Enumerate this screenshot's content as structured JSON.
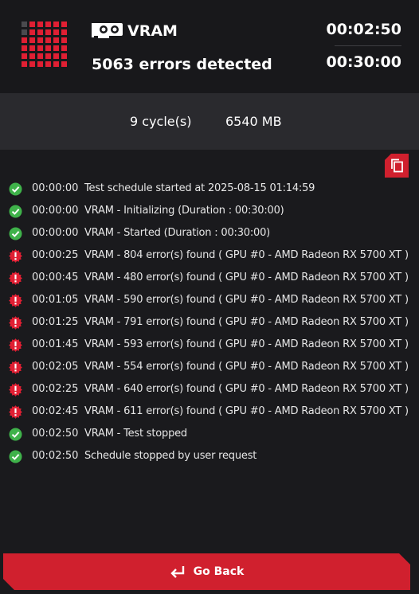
{
  "header": {
    "test_name": "VRAM",
    "errors_text": "5063 errors detected",
    "elapsed_time": "00:02:50",
    "total_time": "00:30:00"
  },
  "stats": {
    "cycles": "9 cycle(s)",
    "memory": "6540 MB"
  },
  "log": [
    {
      "status": "ok",
      "icon": "check-circle-icon",
      "time": "00:00:00",
      "message": "Test schedule started at 2025-08-15 01:14:59"
    },
    {
      "status": "ok",
      "icon": "check-circle-icon",
      "time": "00:00:00",
      "message": "VRAM - Initializing (Duration : 00:30:00)"
    },
    {
      "status": "ok",
      "icon": "check-circle-icon",
      "time": "00:00:00",
      "message": "VRAM - Started (Duration : 00:30:00)"
    },
    {
      "status": "error",
      "icon": "error-gear-icon",
      "time": "00:00:25",
      "message": "VRAM - 804 error(s) found ( GPU #0 - AMD Radeon RX 5700 XT )"
    },
    {
      "status": "error",
      "icon": "error-gear-icon",
      "time": "00:00:45",
      "message": "VRAM - 480 error(s) found ( GPU #0 - AMD Radeon RX 5700 XT )"
    },
    {
      "status": "error",
      "icon": "error-gear-icon",
      "time": "00:01:05",
      "message": "VRAM - 590 error(s) found ( GPU #0 - AMD Radeon RX 5700 XT )"
    },
    {
      "status": "error",
      "icon": "error-gear-icon",
      "time": "00:01:25",
      "message": "VRAM - 791 error(s) found ( GPU #0 - AMD Radeon RX 5700 XT )"
    },
    {
      "status": "error",
      "icon": "error-gear-icon",
      "time": "00:01:45",
      "message": "VRAM - 593 error(s) found ( GPU #0 - AMD Radeon RX 5700 XT )"
    },
    {
      "status": "error",
      "icon": "error-gear-icon",
      "time": "00:02:05",
      "message": "VRAM - 554 error(s) found ( GPU #0 - AMD Radeon RX 5700 XT )"
    },
    {
      "status": "error",
      "icon": "error-gear-icon",
      "time": "00:02:25",
      "message": "VRAM - 640 error(s) found ( GPU #0 - AMD Radeon RX 5700 XT )"
    },
    {
      "status": "error",
      "icon": "error-gear-icon",
      "time": "00:02:45",
      "message": "VRAM - 611 error(s) found ( GPU #0 - AMD Radeon RX 5700 XT )"
    },
    {
      "status": "ok",
      "icon": "check-circle-icon",
      "time": "00:02:50",
      "message": "VRAM - Test stopped"
    },
    {
      "status": "ok",
      "icon": "check-circle-icon",
      "time": "00:02:50",
      "message": "Schedule stopped by user request"
    }
  ],
  "actions": {
    "copy_icon": "copy-icon",
    "go_back_label": "Go Back",
    "go_back_icon": "return-arrow-icon"
  },
  "colors": {
    "accent_red": "#d0202e",
    "ok_green": "#3fb24a",
    "error_red": "#e01f33",
    "background": "#1a1a1d",
    "stats_band": "#2a2a2e"
  }
}
